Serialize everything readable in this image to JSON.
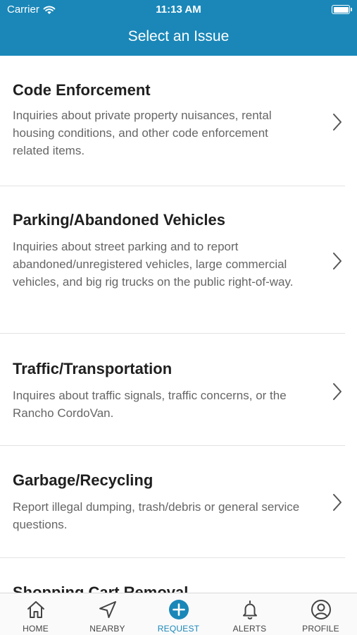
{
  "status_bar": {
    "carrier": "Carrier",
    "time": "11:13 AM"
  },
  "nav": {
    "title": "Select an Issue"
  },
  "issues": [
    {
      "title": "Code Enforcement",
      "description": "Inquiries about private property nuisances, rental housing conditions, and other code enforcement related items."
    },
    {
      "title": "Parking/Abandoned Vehicles",
      "description": "Inquiries about street parking and to report abandoned/unregistered vehicles, large commercial vehicles, and big rig trucks on the public right-of-way."
    },
    {
      "title": "Traffic/Transportation",
      "description": "Inquires about traffic signals, traffic concerns, or the Rancho CordoVan."
    },
    {
      "title": "Garbage/Recycling",
      "description": "Report illegal dumping, trash/debris or general service questions."
    },
    {
      "title": "Shopping Cart Removal",
      "description": ""
    }
  ],
  "tabs": [
    {
      "label": "HOME",
      "icon": "home-icon"
    },
    {
      "label": "NEARBY",
      "icon": "location-arrow-icon"
    },
    {
      "label": "REQUEST",
      "icon": "plus-circle-icon"
    },
    {
      "label": "ALERTS",
      "icon": "bell-icon"
    },
    {
      "label": "PROFILE",
      "icon": "user-circle-icon"
    }
  ],
  "colors": {
    "accent": "#1a87b8",
    "header_bg": "#1a87b8",
    "divider": "#e3e3e3"
  }
}
